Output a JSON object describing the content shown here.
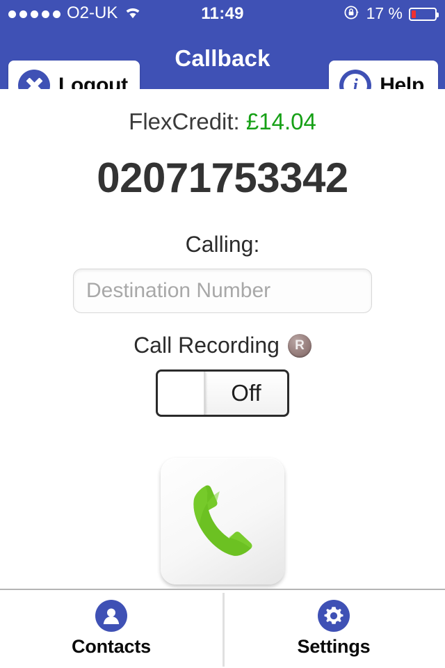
{
  "status_bar": {
    "signal_dots_total": 5,
    "signal_dots_filled": 5,
    "carrier": "O2-UK",
    "wifi_icon": "wifi-icon",
    "time": "11:49",
    "rotation_lock_icon": "rotation-lock-icon",
    "battery_percent": "17 %",
    "battery_level": 17,
    "battery_color": "#f03030",
    "bar_color": "#3f51b5"
  },
  "nav_bar": {
    "title": "Callback",
    "logout": {
      "label": "Logout",
      "icon": "close-x-icon"
    },
    "help": {
      "label": "Help",
      "icon": "info-icon",
      "icon_glyph": "i"
    },
    "accent_color": "#3f51b5"
  },
  "main": {
    "flexcredit_label": "FlexCredit:",
    "flexcredit_amount": "£14.04",
    "flexcredit_amount_color": "#16a016",
    "phone_number": "02071753342",
    "calling_label": "Calling:",
    "destination": {
      "value": "",
      "placeholder": "Destination Number"
    },
    "call_recording": {
      "label": "Call Recording",
      "badge_icon": "registered-r-icon",
      "badge_glyph": "R",
      "toggle_state": "Off",
      "toggle_on": false
    },
    "call_button": {
      "icon": "phone-handset-icon",
      "icon_color": "#6cc122"
    }
  },
  "tab_bar": {
    "items": [
      {
        "label": "Contacts",
        "icon": "person-icon"
      },
      {
        "label": "Settings",
        "icon": "gear-icon"
      }
    ]
  }
}
